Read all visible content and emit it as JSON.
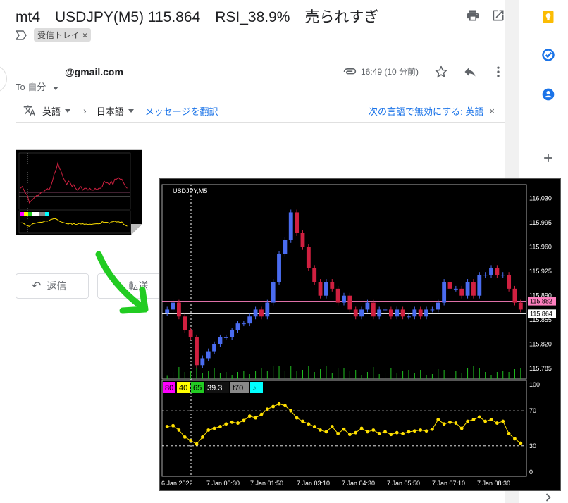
{
  "email": {
    "subject": "mt4　USDJPY(M5) 115.864　RSI_38.9%　売られすぎ",
    "label": "受信トレイ",
    "label_close": "×",
    "sender": "@gmail.com",
    "to": "To 自分",
    "time": "16:49 (10 分前)"
  },
  "translate": {
    "source": "英語",
    "target": "日本語",
    "translate_link": "メッセージを翻訳",
    "disable_text": "次の言語で無効にする: 英語",
    "close": "×"
  },
  "buttons": {
    "reply": "返信",
    "forward": "転送"
  },
  "icons": {
    "print": "print-icon",
    "open": "open-in-new-icon",
    "attach": "paperclip-icon",
    "star": "star-icon",
    "reply": "reply-icon",
    "more": "more-vert-icon",
    "keep": "keep-icon",
    "tasks": "tasks-icon",
    "contacts": "contacts-icon",
    "add": "add-icon"
  },
  "colors": {
    "bull": "#4a6cf0",
    "bear": "#d02040",
    "volume": "#20c020",
    "rsi": "#ffe000",
    "current_line": "#ffffff",
    "pink_line": "#ff80c0",
    "green_arrow": "#22cc22"
  },
  "chart": {
    "symbol": "USDJPY,M5",
    "price_ticks": [
      "116.030",
      "115.995",
      "115.960",
      "115.925",
      "115.890",
      "115.855",
      "115.820",
      "115.785"
    ],
    "price_pink": "115.882",
    "price_current": "115.864",
    "rsi_ticks": [
      "100",
      "70",
      "30",
      "0"
    ],
    "time_ticks": [
      "6 Jan 2022",
      "7 Jan 00:30",
      "7 Jan 01:50",
      "7 Jan 03:10",
      "7 Jan 04:30",
      "7 Jan 05:50",
      "7 Jan 07:10",
      "7 Jan 08:30"
    ],
    "rsi_buttons": [
      {
        "label": "80",
        "bg": "#ff00ff",
        "fg": "#000"
      },
      {
        "label": "40",
        "bg": "#ffff00",
        "fg": "#000"
      },
      {
        "label": "65",
        "bg": "#22cc22",
        "fg": "#000"
      },
      {
        "label": "39.3",
        "bg": "#111111",
        "fg": "#fff"
      },
      {
        "label": "t70",
        "bg": "#888888",
        "fg": "#000"
      },
      {
        "label": "♪",
        "bg": "#00ffff",
        "fg": "#000"
      }
    ]
  },
  "chart_data": {
    "type": "line",
    "title": "USDJPY,M5",
    "price_ylim": [
      115.77,
      116.05
    ],
    "rsi_ylim": [
      0,
      100
    ],
    "rsi_levels": [
      70,
      30
    ],
    "close_series": [
      115.87,
      115.88,
      115.86,
      115.84,
      115.83,
      115.79,
      115.8,
      115.81,
      115.82,
      115.83,
      115.83,
      115.84,
      115.85,
      115.85,
      115.86,
      115.87,
      115.86,
      115.88,
      115.91,
      115.95,
      115.97,
      116.01,
      115.98,
      115.96,
      115.93,
      115.91,
      115.89,
      115.91,
      115.9,
      115.88,
      115.89,
      115.87,
      115.86,
      115.87,
      115.88,
      115.86,
      115.87,
      115.87,
      115.86,
      115.87,
      115.86,
      115.86,
      115.87,
      115.86,
      115.87,
      115.87,
      115.88,
      115.91,
      115.9,
      115.9,
      115.89,
      115.91,
      115.89,
      115.92,
      115.92,
      115.93,
      115.92,
      115.92,
      115.9,
      115.88,
      115.87
    ],
    "rsi_series": [
      52,
      53,
      48,
      40,
      36,
      32,
      40,
      48,
      50,
      52,
      55,
      57,
      56,
      59,
      64,
      62,
      66,
      72,
      75,
      78,
      76,
      70,
      62,
      58,
      55,
      52,
      48,
      46,
      52,
      44,
      49,
      43,
      45,
      50,
      46,
      48,
      44,
      46,
      43,
      45,
      44,
      46,
      47,
      48,
      47,
      49,
      60,
      55,
      57,
      56,
      50,
      58,
      60,
      63,
      58,
      60,
      56,
      58,
      44,
      38,
      33
    ]
  }
}
